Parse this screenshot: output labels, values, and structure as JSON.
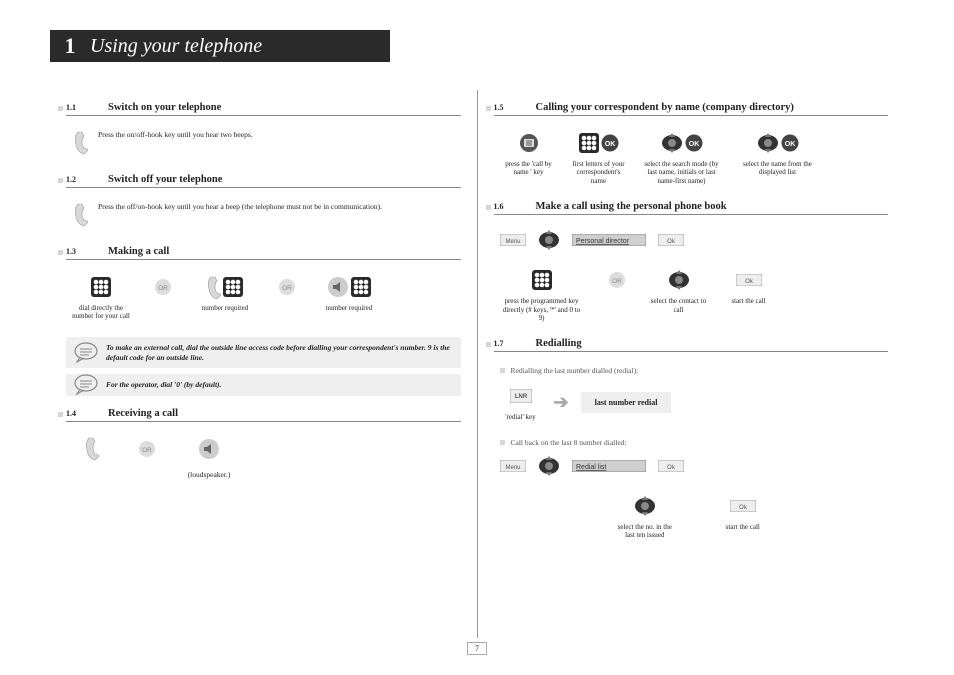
{
  "chapter": {
    "number": "1",
    "title": "Using your telephone"
  },
  "page_number": "7",
  "left": {
    "s11": {
      "num": "1.1",
      "title": "Switch on your telephone",
      "text": "Press the on/off-hook key until you hear two beeps."
    },
    "s12": {
      "num": "1.2",
      "title": "Switch off your telephone",
      "text": "Press the off/on-hook key until you hear a beep (the telephone must not be in communication)."
    },
    "s13": {
      "num": "1.3",
      "title": "Making a call",
      "items": [
        "dial directly the number for your call",
        "OR",
        "number required",
        "OR",
        "number required"
      ],
      "note1": "To make an external call, dial the outside line access code before dialling your correspondent's number. 9 is the default code for an outside line.",
      "note2": "For the operator, dial '0' (by default)."
    },
    "s14": {
      "num": "1.4",
      "title": "Receiving a call",
      "caption": "(loudspeaker.)"
    }
  },
  "right": {
    "s15": {
      "num": "1.5",
      "title": "Calling your correspondent by name (company directory)",
      "items": [
        "press the 'call by name ' key",
        "first letters of your correspondent's name",
        "OK",
        "select the search mode (by last name, initials or last name-first name)",
        "OK",
        "select the name from the displayed list",
        "OK"
      ]
    },
    "s16": {
      "num": "1.6",
      "title": "Make a call using the personal phone book",
      "menu_label": "Menu",
      "display": "Personal director",
      "ok_label": "Ok",
      "items": [
        "press the programmed key directly (# keys, '*' and 0 to 9)",
        "OR",
        "select the contact to call",
        "start the call"
      ]
    },
    "s17": {
      "num": "1.7",
      "title": "Redialling",
      "sub1": "Redialling the last number dialled (redial):",
      "redial_key": "'redial' key",
      "lnr_badge": "LNR",
      "result": "last number redial",
      "sub2": "Call back on the last 8 number dialled:",
      "menu_label": "Menu",
      "display2": "Redial list",
      "ok_label": "Ok",
      "items2": [
        "select the no. in the last ten issued",
        "start the call"
      ]
    }
  }
}
